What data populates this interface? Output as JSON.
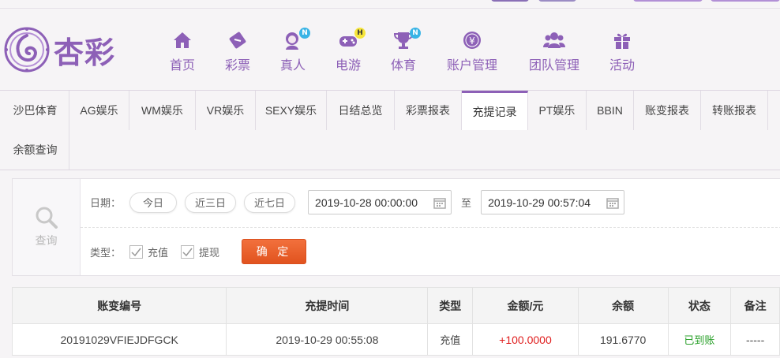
{
  "brand": {
    "name": "杏彩",
    "color": "#8d60b7"
  },
  "nav": [
    {
      "label": "首页",
      "icon": "home-icon"
    },
    {
      "label": "彩票",
      "icon": "lottery-ticket-icon"
    },
    {
      "label": "真人",
      "icon": "live-dealer-icon",
      "badge": "N"
    },
    {
      "label": "电游",
      "icon": "gamepad-icon",
      "badge": "H"
    },
    {
      "label": "体育",
      "icon": "trophy-icon",
      "badge": "N"
    },
    {
      "label": "账户管理",
      "icon": "yen-coin-icon"
    },
    {
      "label": "团队管理",
      "icon": "team-icon"
    },
    {
      "label": "活动",
      "icon": "gift-icon"
    }
  ],
  "tabs": [
    "沙巴体育",
    "AG娱乐",
    "WM娱乐",
    "VR娱乐",
    "SEXY娱乐",
    "日结总览",
    "彩票报表",
    "充提记录",
    "PT娱乐",
    "BBIN",
    "账变报表",
    "转账报表",
    "余额查询"
  ],
  "active_tab": "充提记录",
  "filter": {
    "side_label": "查询",
    "date_label": "日期：",
    "quick_ranges": [
      "今日",
      "近三日",
      "近七日"
    ],
    "start_date": "2019-10-28 00:00:00",
    "to_label": "至",
    "end_date": "2019-10-29 00:57:04",
    "type_label": "类型：",
    "types": [
      "充值",
      "提现"
    ],
    "confirm_label": "确 定"
  },
  "table": {
    "headers": [
      "账变编号",
      "充提时间",
      "类型",
      "金额/元",
      "余额",
      "状态",
      "备注"
    ],
    "rows": [
      [
        "20191029VFIEJDFGCK",
        "2019-10-29 00:55:08",
        "充值",
        "+100.0000",
        "191.6770",
        "已到账",
        "-----"
      ]
    ]
  }
}
